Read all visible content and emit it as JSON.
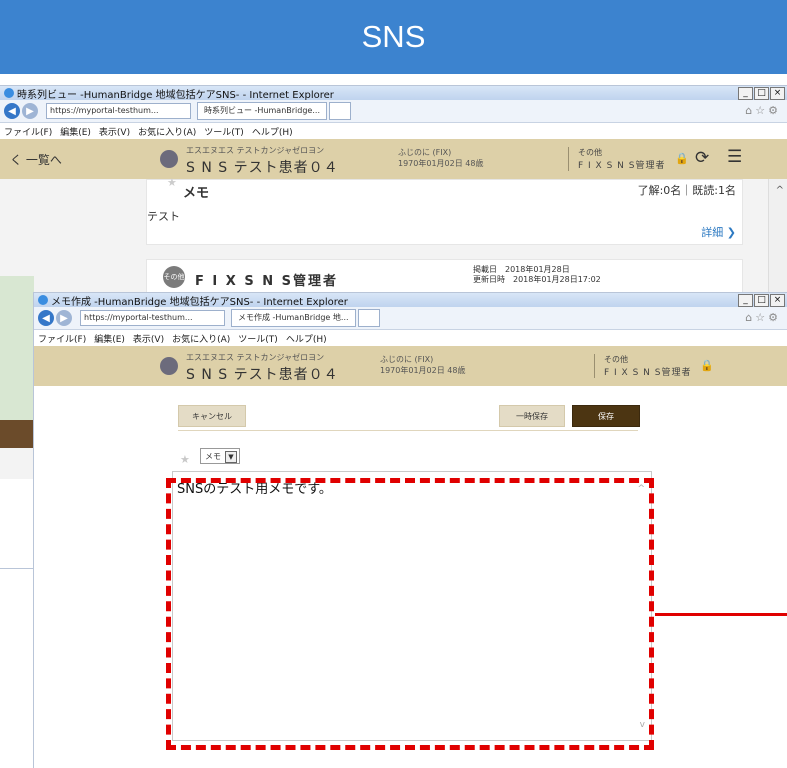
{
  "banner": {
    "title": "SNS"
  },
  "window1": {
    "title": "時系列ビュー -HumanBridge 地域包括ケアSNS- - Internet Explorer",
    "url": "https://myportal-testhum...",
    "tab_label": "時系列ビュー -HumanBridge...",
    "menu": [
      "ファイル(F)",
      "編集(E)",
      "表示(V)",
      "お気に入り(A)",
      "ツール(T)",
      "ヘルプ(H)"
    ],
    "header": {
      "back_label": "く 一覧へ",
      "patient_kana": "エスエヌエス テストカンジャゼロヨン",
      "patient_name": "S N S テスト患者０４",
      "birth_kana": "ふじのに (FIX)",
      "birth_date": "1970年01月02日 48歳",
      "role_small": "その他",
      "role_name": "F I X  S N S管理者"
    },
    "memo_card": {
      "title": "メモ",
      "stats": "了解:0名｜既読:1名",
      "body": "テスト",
      "detail": "詳細 ❯"
    },
    "post_card": {
      "badge": "その他",
      "author": "F I X  S N S管理者",
      "date_line1": "掲載日　2018年01月28日",
      "date_line2": "更新日時　2018年01月28日17:02"
    }
  },
  "window2": {
    "title": "メモ作成 -HumanBridge 地域包括ケアSNS- - Internet Explorer",
    "url": "https://myportal-testhum...",
    "tab_label": "メモ作成 -HumanBridge 地...",
    "menu": [
      "ファイル(F)",
      "編集(E)",
      "表示(V)",
      "お気に入り(A)",
      "ツール(T)",
      "ヘルプ(H)"
    ],
    "header": {
      "patient_kana": "エスエヌエス テストカンジャゼロヨン",
      "patient_name": "S N S テスト患者０４",
      "birth_kana": "ふじのに (FIX)",
      "birth_date": "1970年01月02日 48歳",
      "role_small": "その他",
      "role_name": "F I X  S N S管理者"
    },
    "buttons": {
      "cancel": "キャンセル",
      "temp_save": "一時保存",
      "save": "保存"
    },
    "select_value": "メモ",
    "textarea_value": "SNSのテスト用メモです。"
  },
  "colors": {
    "banner": "#3c83cf",
    "header": "#ddd0a8",
    "save_button": "#4c3512",
    "highlight": "#e00000"
  }
}
